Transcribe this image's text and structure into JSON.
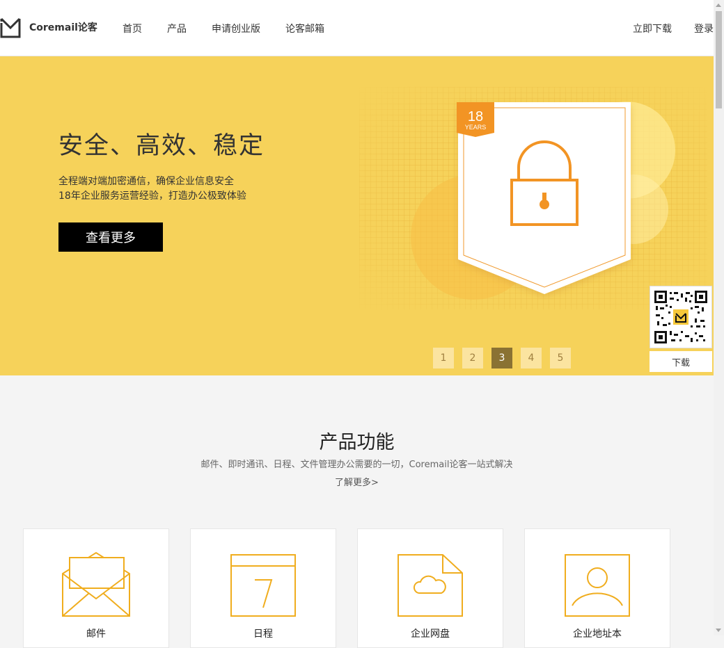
{
  "header": {
    "logo_text": "Coremail论客",
    "nav": [
      "首页",
      "产品",
      "申请创业版",
      "论客邮箱"
    ],
    "right": [
      "立即下载",
      "登录"
    ]
  },
  "banner": {
    "headline": "安全、高效、稳定",
    "desc_line1": "全程端对端加密通信，确保企业信息安全",
    "desc_line2": "18年企业服务运营经验，打造办公极致体验",
    "cta": "查看更多",
    "badge_number": "18",
    "badge_text": "YEARS",
    "background_color": "#f6d25a",
    "pages": [
      "1",
      "2",
      "3",
      "4",
      "5"
    ],
    "active_page": "3"
  },
  "qr": {
    "download_label": "下载"
  },
  "products": {
    "title": "产品功能",
    "subtitle": "邮件、即时通讯、日程、文件管理办公需要的一切，Coremail论客一站式解决",
    "more": "了解更多>",
    "cards": [
      {
        "label": "邮件",
        "icon": "mail-envelope-icon"
      },
      {
        "label": "日程",
        "icon": "calendar-icon"
      },
      {
        "label": "企业网盘",
        "icon": "cloud-drive-icon"
      },
      {
        "label": "企业地址本",
        "icon": "contact-book-icon"
      }
    ],
    "accent": "#f0ad1e"
  }
}
